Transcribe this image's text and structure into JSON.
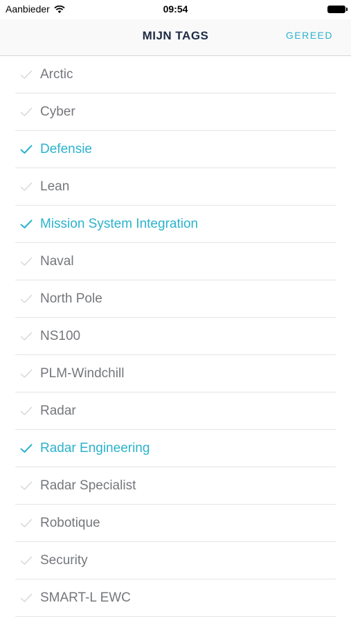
{
  "status_bar": {
    "carrier": "Aanbieder",
    "time": "09:54"
  },
  "nav": {
    "title": "MIJN TAGS",
    "done_label": "GEREED"
  },
  "colors": {
    "accent": "#2bb2cd",
    "text": "#74777b",
    "check_inactive": "#d6d6d6"
  },
  "tags": [
    {
      "label": "Arctic",
      "selected": false
    },
    {
      "label": "Cyber",
      "selected": false
    },
    {
      "label": "Defensie",
      "selected": true
    },
    {
      "label": "Lean",
      "selected": false
    },
    {
      "label": "Mission System Integration",
      "selected": true
    },
    {
      "label": "Naval",
      "selected": false
    },
    {
      "label": "North Pole",
      "selected": false
    },
    {
      "label": "NS100",
      "selected": false
    },
    {
      "label": "PLM-Windchill",
      "selected": false
    },
    {
      "label": "Radar",
      "selected": false
    },
    {
      "label": "Radar Engineering",
      "selected": true
    },
    {
      "label": "Radar Specialist",
      "selected": false
    },
    {
      "label": "Robotique",
      "selected": false
    },
    {
      "label": "Security",
      "selected": false
    },
    {
      "label": "SMART-L EWC",
      "selected": false
    }
  ]
}
